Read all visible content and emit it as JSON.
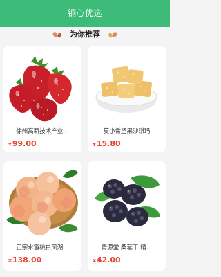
{
  "header": {
    "title": "铜心优选"
  },
  "section": {
    "title": "为你推荐"
  },
  "products": [
    {
      "name": "徐州高新技术产业…",
      "currency": "¥",
      "price": "99.00",
      "image": "strawberry-image"
    },
    {
      "name": "莫小希坚果沙琪玛",
      "currency": "¥",
      "price": "15.80",
      "image": "sachima-image"
    },
    {
      "name": "正宗水蜜桃白凤湖…",
      "currency": "¥",
      "price": "138.00",
      "image": "peach-image"
    },
    {
      "name": "青源堂 桑葚干 精…",
      "currency": "¥",
      "price": "42.00",
      "image": "mulberry-image"
    }
  ],
  "colors": {
    "brand": "#3cbb79",
    "price": "#e8452f",
    "background": "#f4f4f4"
  }
}
